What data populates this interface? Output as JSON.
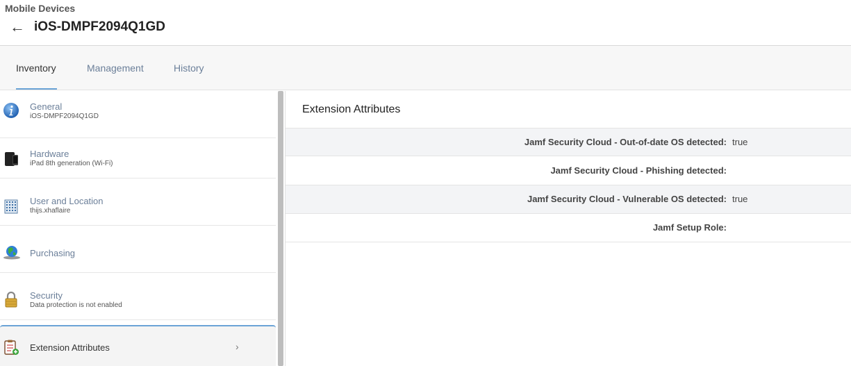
{
  "header": {
    "breadcrumb": "Mobile Devices",
    "title": "iOS-DMPF2094Q1GD",
    "back_glyph": "←"
  },
  "tabs": [
    {
      "label": "Inventory",
      "active": true
    },
    {
      "label": "Management",
      "active": false
    },
    {
      "label": "History",
      "active": false
    }
  ],
  "sidebar": {
    "items": [
      {
        "name": "General",
        "sub": "iOS-DMPF2094Q1GD",
        "icon": "info-icon"
      },
      {
        "name": "Hardware",
        "sub": "iPad 8th generation (Wi-Fi)",
        "icon": "device-icon"
      },
      {
        "name": "User and Location",
        "sub": "thijs.xhaflaire",
        "icon": "building-icon"
      },
      {
        "name": "Purchasing",
        "sub": "",
        "icon": "globe-icon"
      },
      {
        "name": "Security",
        "sub": "Data protection is not enabled",
        "icon": "lock-icon"
      },
      {
        "name": "Extension Attributes",
        "sub": "",
        "icon": "clipboard-icon",
        "chevron": "›"
      }
    ]
  },
  "main": {
    "title": "Extension Attributes",
    "rows": [
      {
        "label": "Jamf Security Cloud - Out-of-date OS detected:",
        "value": "true"
      },
      {
        "label": "Jamf Security Cloud - Phishing detected:",
        "value": ""
      },
      {
        "label": "Jamf Security Cloud - Vulnerable OS detected:",
        "value": "true"
      },
      {
        "label": "Jamf Setup Role:",
        "value": ""
      }
    ]
  },
  "colors": {
    "accent": "#6aa3d6",
    "link": "#6b7f99"
  }
}
